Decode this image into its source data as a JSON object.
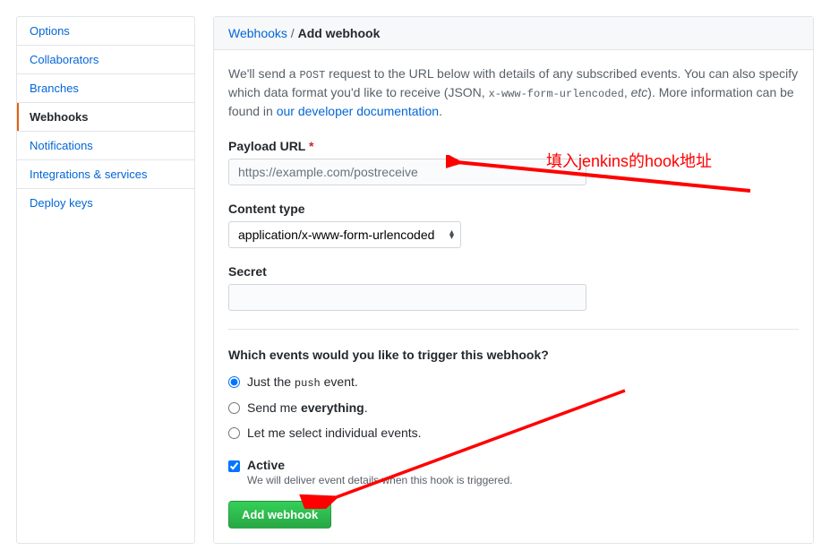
{
  "sidebar": {
    "items": [
      {
        "label": "Options"
      },
      {
        "label": "Collaborators"
      },
      {
        "label": "Branches"
      },
      {
        "label": "Webhooks"
      },
      {
        "label": "Notifications"
      },
      {
        "label": "Integrations & services"
      },
      {
        "label": "Deploy keys"
      }
    ]
  },
  "header": {
    "crumb_root": "Webhooks",
    "crumb_sep": "/",
    "crumb_page": "Add webhook"
  },
  "intro": {
    "pre": "We'll send a ",
    "code1": "POST",
    "mid1": " request to the URL below with details of any subscribed events. You can also specify which data format you'd like to receive (JSON, ",
    "code2": "x-www-form-urlencoded",
    "mid2": ", ",
    "em": "etc",
    "mid3": "). More information can be found in ",
    "link": "our developer documentation",
    "post": "."
  },
  "form": {
    "payload_label": "Payload URL",
    "required": "*",
    "payload_placeholder": "https://example.com/postreceive",
    "content_type_label": "Content type",
    "content_type_value": "application/x-www-form-urlencoded",
    "secret_label": "Secret",
    "events_title": "Which events would you like to trigger this webhook?",
    "opt1_pre": "Just the ",
    "opt1_code": "push",
    "opt1_post": " event.",
    "opt2_pre": "Send me ",
    "opt2_strong": "everything",
    "opt2_post": ".",
    "opt3": "Let me select individual events.",
    "active_label": "Active",
    "active_desc": "We will deliver event details when this hook is triggered.",
    "submit": "Add webhook"
  },
  "annotations": {
    "note1": "填入jenkins的hook地址"
  }
}
